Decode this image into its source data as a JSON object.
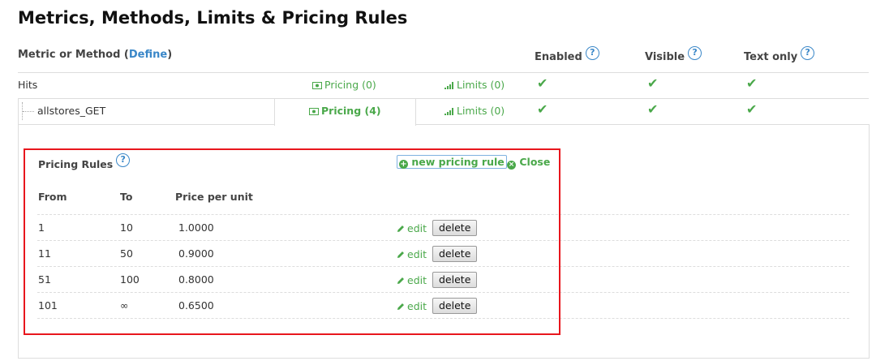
{
  "page": {
    "title": "Metrics, Methods, Limits & Pricing Rules"
  },
  "columns": {
    "metric_label": "Metric or Method (",
    "define_link": "Define",
    "metric_label_end": ")",
    "enabled": "Enabled",
    "visible": "Visible",
    "text_only": "Text only",
    "help_glyph": "?"
  },
  "rows": [
    {
      "name": "Hits",
      "pricing": "Pricing (0)",
      "limits": "Limits (0)",
      "enabled": "✔",
      "visible": "✔",
      "text_only": "✔"
    },
    {
      "name": "allstores_GET",
      "pricing": "Pricing (4)",
      "limits": "Limits (0)",
      "enabled": "✔",
      "visible": "✔",
      "text_only": "✔"
    }
  ],
  "pricing_panel": {
    "title": "Pricing Rules",
    "new_rule": "new pricing rule",
    "close": "Close",
    "headers": {
      "from": "From",
      "to": "To",
      "price": "Price per unit"
    },
    "edit_label": "edit",
    "delete_label": "delete",
    "rules": [
      {
        "from": "1",
        "to": "10",
        "price": "1.0000"
      },
      {
        "from": "11",
        "to": "50",
        "price": "0.9000"
      },
      {
        "from": "51",
        "to": "100",
        "price": "0.8000"
      },
      {
        "from": "101",
        "to": "∞",
        "price": "0.6500"
      }
    ]
  },
  "colors": {
    "accent_green": "#4aa84a",
    "link_blue": "#3a87c8",
    "highlight_red": "#e8161d"
  },
  "icons": {
    "pricing": "money-icon",
    "limits": "bar-signal-icon",
    "edit": "pencil-icon",
    "new": "plus-circle-icon",
    "close": "x-circle-icon",
    "check": "checkmark-icon"
  }
}
